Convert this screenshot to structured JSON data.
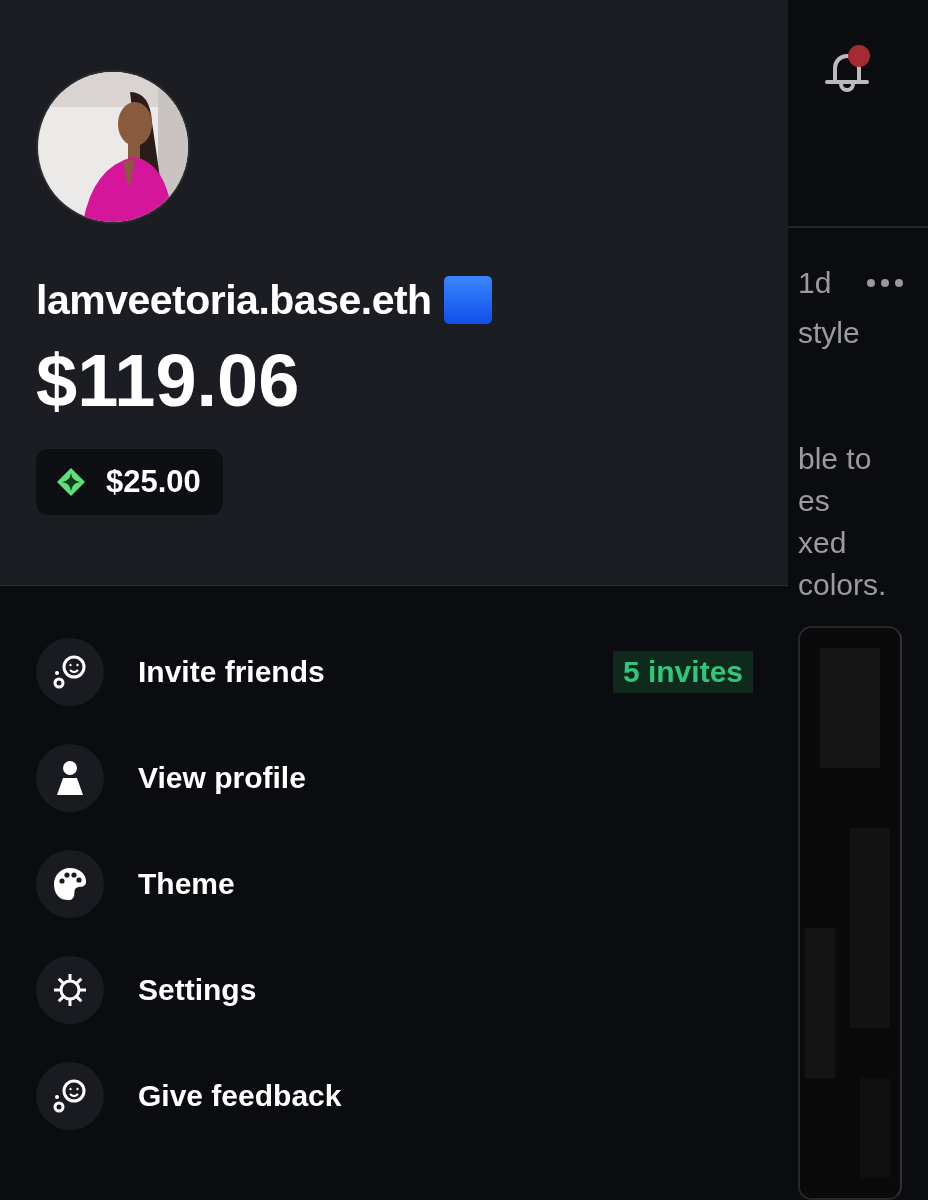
{
  "drawer": {
    "username": "lamveetoria.base.eth",
    "balance": "$119.06",
    "credit": "$25.00",
    "menu": [
      {
        "kind": "smile",
        "label": "Invite friends",
        "badge": "5 invites"
      },
      {
        "kind": "person",
        "label": "View profile"
      },
      {
        "kind": "palette",
        "label": "Theme"
      },
      {
        "kind": "gear",
        "label": "Settings"
      },
      {
        "kind": "smile",
        "label": "Give feedback"
      }
    ]
  },
  "background": {
    "notification_unread": true,
    "post": {
      "time": "1d",
      "lines": [
        "style",
        "ble to",
        "es",
        "xed",
        "colors."
      ]
    }
  }
}
